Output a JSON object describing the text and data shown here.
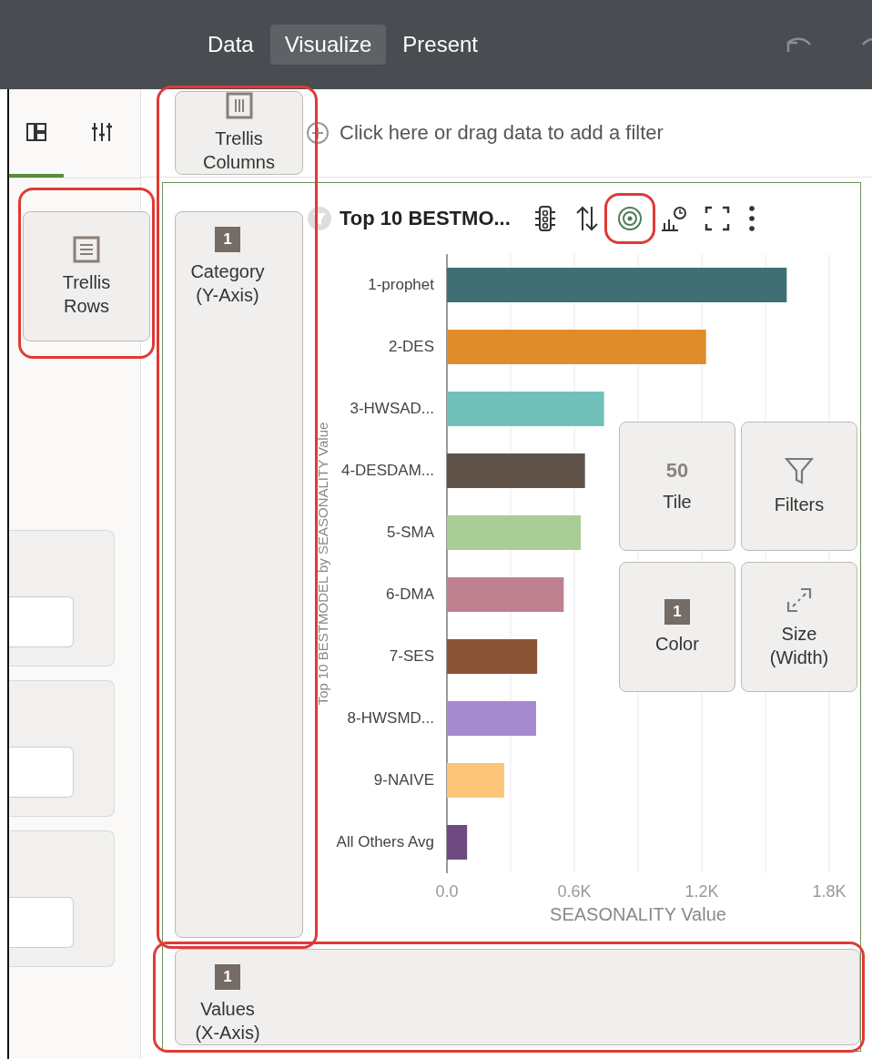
{
  "header": {
    "tabs": [
      {
        "label": "Data",
        "selected": false
      },
      {
        "label": "Visualize",
        "selected": true
      },
      {
        "label": "Present",
        "selected": false
      }
    ]
  },
  "panel_tabs": [
    {
      "selected": true
    },
    {
      "selected": false
    }
  ],
  "filter_bar": {
    "placeholder": "Click here or drag data to add a filter"
  },
  "chart_data": {
    "type": "bar",
    "orientation": "horizontal",
    "title": "Top 10 BESTMO...",
    "ylabel": "Top 10 BESTMODEL by SEASONALITY Value",
    "xlabel": "SEASONALITY Value",
    "categories": [
      "1-prophet",
      "2-DES",
      "3-HWSAD...",
      "4-DESDAM...",
      "5-SMA",
      "6-DMA",
      "7-SES",
      "8-HWSMD...",
      "9-NAIVE",
      "All Others Avg"
    ],
    "series": [
      {
        "values": [
          1600,
          1220,
          740,
          650,
          630,
          550,
          425,
          420,
          270,
          95
        ]
      }
    ],
    "colors": [
      "#3f6f73",
      "#e08c2b",
      "#71c1ba",
      "#5f5349",
      "#a9cd95",
      "#bf8190",
      "#8b5335",
      "#a68ad0",
      "#fbc679",
      "#6c4a80"
    ],
    "xlim": [
      0,
      1800
    ],
    "xticks": [
      {
        "value": 0,
        "label": "0.0"
      },
      {
        "value": 600,
        "label": "0.6K"
      },
      {
        "value": 1200,
        "label": "1.2K"
      },
      {
        "value": 1800,
        "label": "1.8K"
      }
    ]
  },
  "drop_zones": [
    {
      "kind": "columns",
      "label": "Trellis Columns"
    },
    {
      "kind": "rows",
      "label": "Trellis Rows"
    },
    {
      "kind": "badge",
      "count": "1",
      "label": "Category (Y-Axis)"
    },
    {
      "kind": "number",
      "icon_text": "50",
      "label": "Tile"
    },
    {
      "kind": "filter",
      "label": "Filters"
    },
    {
      "kind": "badge",
      "count": "1",
      "label": "Color"
    },
    {
      "kind": "resize",
      "label": "Size (Width)"
    },
    {
      "kind": "badge",
      "count": "1",
      "label": "Values (X-Axis)"
    }
  ]
}
